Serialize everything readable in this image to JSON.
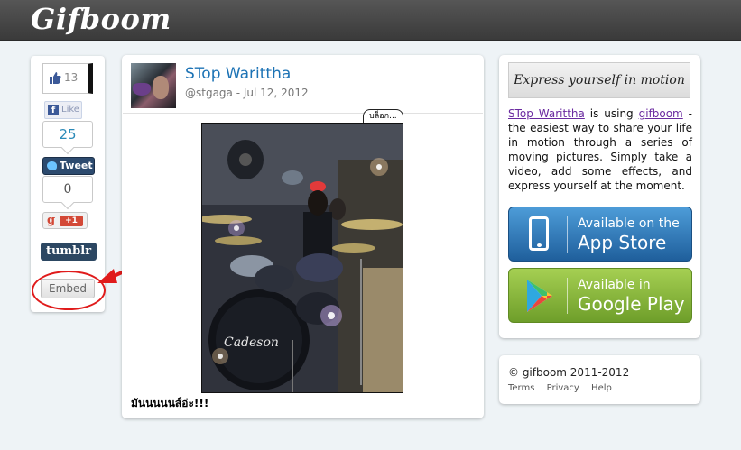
{
  "header": {
    "logo": "Gifboom"
  },
  "share": {
    "fb_count": "13",
    "fb_like_label": "Like",
    "tweet_count": "25",
    "tweet_label": "Tweet",
    "gplus_count": "0",
    "gplus_label": "+1",
    "tumblr_label": "tumblr",
    "embed_label": "Embed"
  },
  "post": {
    "author": "STop Warittha",
    "handle": "@stgaga",
    "date": "Jul 12, 2012",
    "date_sep": " - ",
    "tag": "บล็อก...",
    "caption": "มันนนนนส์อ่ะ!!!",
    "drum_brand": "Cadeson"
  },
  "promo": {
    "tagline": "Express yourself in motion",
    "desc_user": "STop Warittha",
    "desc_is_using": " is using ",
    "desc_app": "gifboom",
    "desc_rest": " - the easiest way to share your life in motion through a series of moving pictures. Simply take a video, add some effects, and express yourself at the moment.",
    "appstore_small": "Available on the",
    "appstore_big": "App Store",
    "gplay_small": "Available in",
    "gplay_big": "Google Play"
  },
  "footer": {
    "copyright": "© gifboom 2011-2012",
    "links": [
      "Terms",
      "Privacy",
      "Help"
    ]
  },
  "colors": {
    "accent_link": "#1d73b5",
    "annotation_red": "#e01b1b",
    "appstore_blue": "#2f77b8",
    "gplay_green": "#8ab83f"
  }
}
